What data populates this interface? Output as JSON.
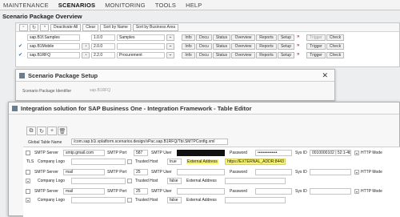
{
  "menu": [
    "MAINTENANCE",
    "SCENARIOS",
    "MONITORING",
    "TOOLS",
    "HELP"
  ],
  "page_title": "Scenario Package Overview",
  "overview": {
    "toolbar": {
      "deactivate_all": "Deactivate All",
      "clear": "Clear",
      "sort_by_name": "Sort by Name",
      "sort_by_business_area": "Sort by Business Area"
    },
    "rows": [
      {
        "name": "sap.B1f.Samples",
        "version": "1.0.0",
        "description": "Samples"
      },
      {
        "name": "sap.B1Mobile",
        "version": "2.0.0",
        "description": ""
      },
      {
        "name": "sap.B1RFQ",
        "version": "2.2.0",
        "description": "Procurement"
      }
    ],
    "buttons": {
      "info": "Info",
      "docu": "Docu",
      "status": "Status",
      "overview": "Overview",
      "reports": "Reports",
      "setup": "Setup",
      "trigger": "Trigger",
      "check": "Check"
    }
  },
  "setup_dialog": {
    "title": "Scenario Package Setup",
    "label": "Scenario Package Identifier",
    "value": "sap.B1RFQ"
  },
  "editor": {
    "title": "Integration solution for SAP Business One - Integration Framework - Table Editor",
    "global_table_name_label": "Global Table Name",
    "global_table_name_value": "/com.sap.b1i.vplatform.scenarios.design/vPac.sap.B1RFQ/Tbl.SMTPConfig.xml",
    "labels": {
      "smtp_server": "SMTP Server",
      "smtp_port": "SMTP Port",
      "smtp_user": "SMTP User",
      "password": "Password",
      "sys_id": "Sys ID",
      "http_mode": "HTTP Mode",
      "company_logo": "Company Logo",
      "trusted_host": "Trusted Host",
      "external_address": "External Address"
    },
    "rows": [
      {
        "smtp_server": "smtp.gmail.com",
        "smtp_port": "587",
        "password": "••••••••••••••",
        "sys_id": "0010000102 | 52:1-4b",
        "tls": "TLS",
        "trusted_host": "true",
        "external_address": "https://EXTERNAL_ADDR:8443"
      },
      {
        "smtp_server": "mail",
        "smtp_port": "25",
        "password": "",
        "sys_id": "",
        "tls": "",
        "trusted_host": "false",
        "external_address": ""
      },
      {
        "smtp_server": "mail",
        "smtp_port": "25",
        "password": "",
        "sys_id": "",
        "tls": "",
        "trusted_host": "false",
        "external_address": ""
      }
    ]
  },
  "colors": {
    "highlight": "#f7f56b",
    "chevron": "#c0392b"
  }
}
